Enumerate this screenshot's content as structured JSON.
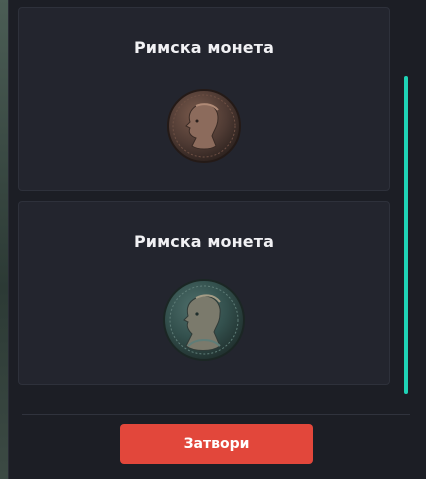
{
  "items": [
    {
      "title": "Римска монета",
      "icon": "bronze-roman-coin-icon"
    },
    {
      "title": "Римска монета",
      "icon": "patina-roman-coin-icon"
    }
  ],
  "footer": {
    "close_label": "Затвори"
  },
  "colors": {
    "accent": "#1fd3b6",
    "button": "#e2473b",
    "panel": "#1c1e25",
    "card": "#23252e"
  }
}
